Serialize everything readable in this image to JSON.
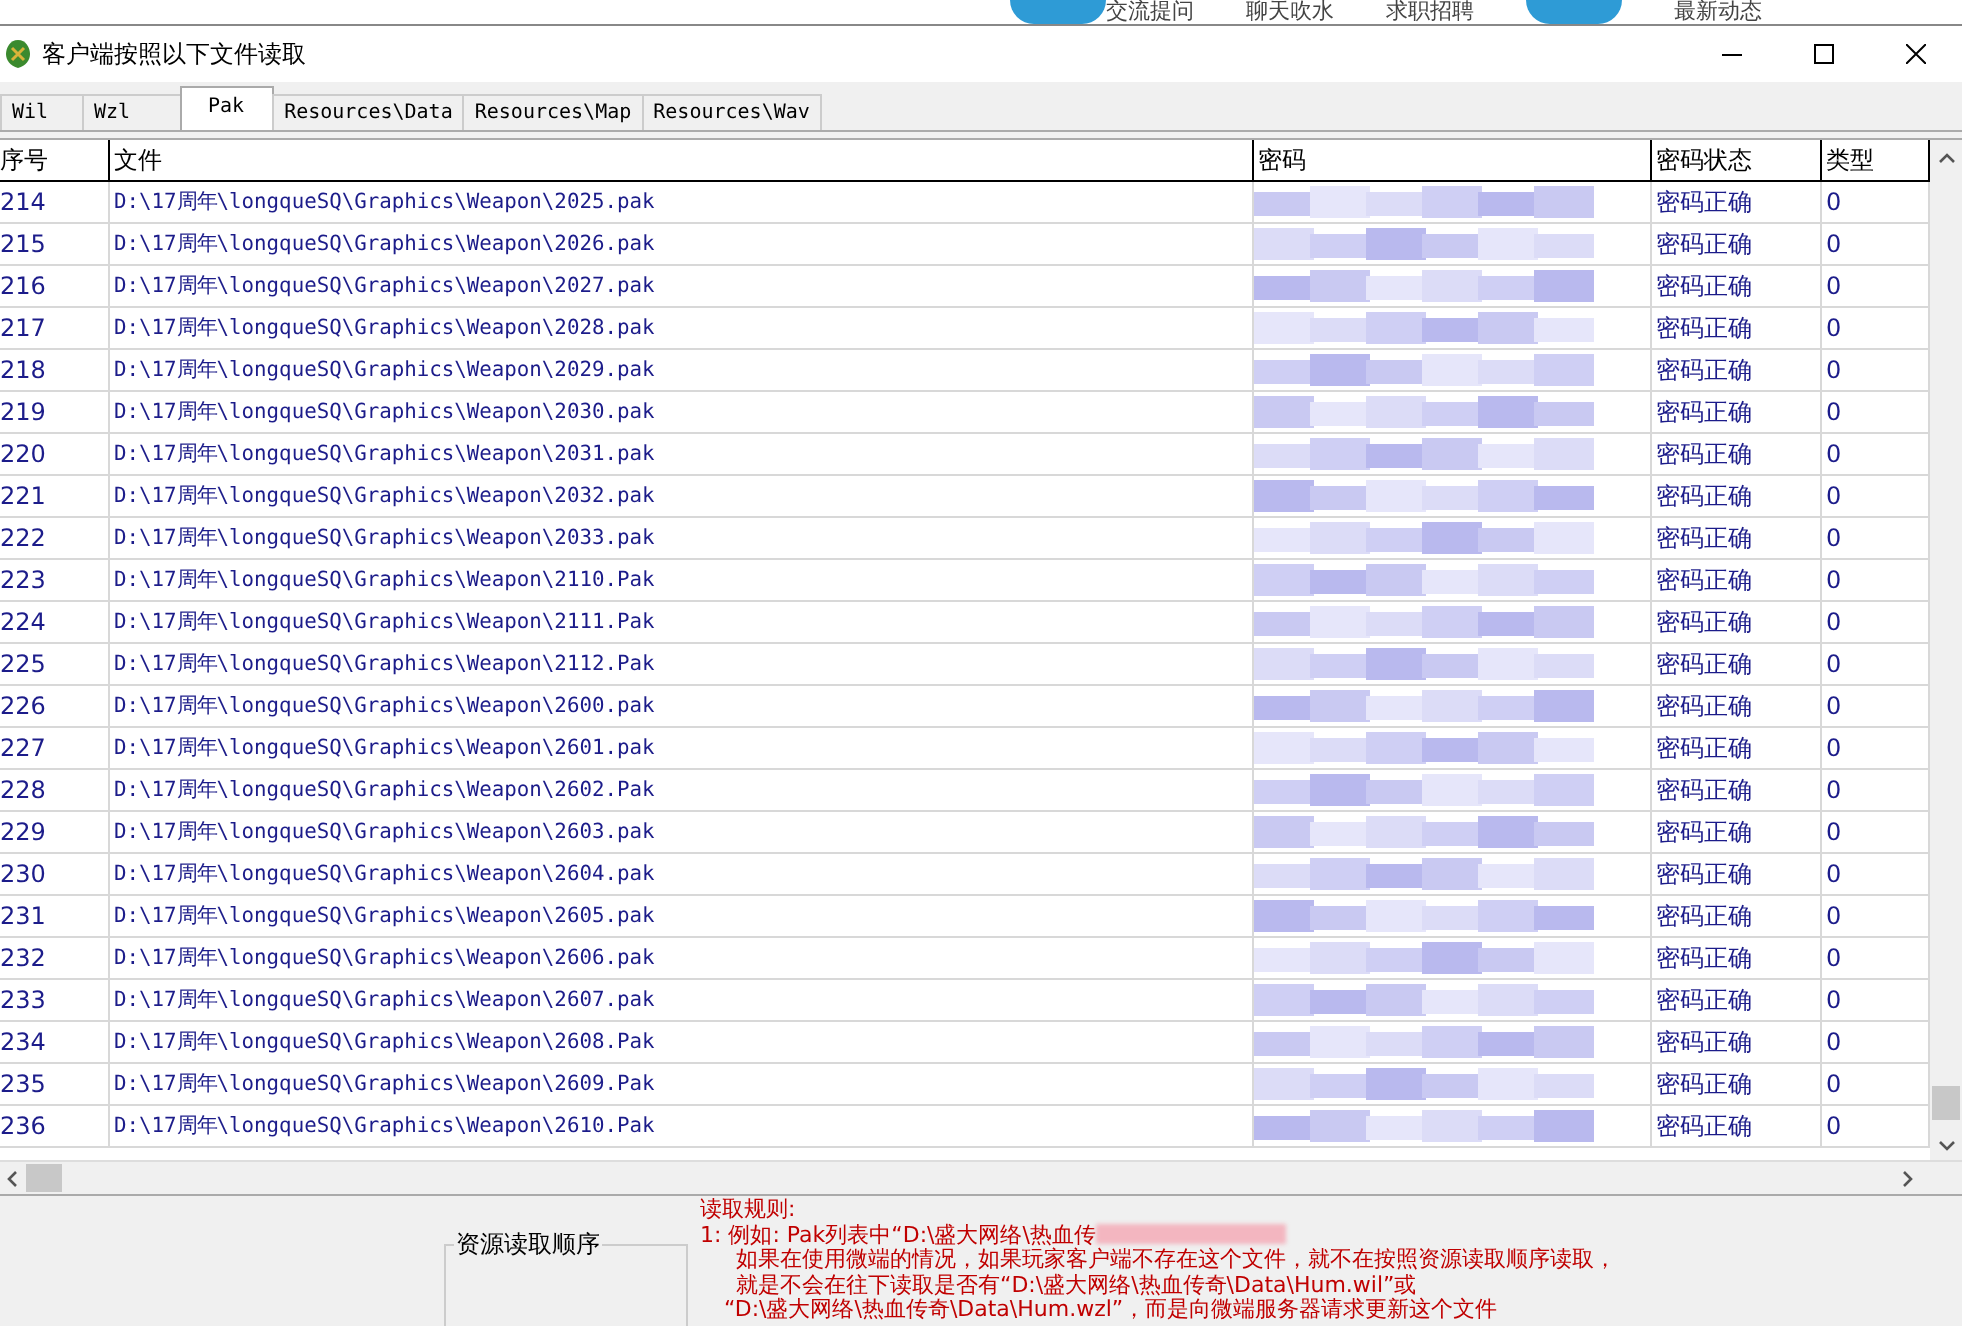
{
  "background_page": {
    "links": [
      "交流提问",
      "聊天吹水",
      "求职招聘",
      "最新动态"
    ]
  },
  "window": {
    "title": "客户端按照以下文件读取"
  },
  "tabs": [
    {
      "label": "Wil",
      "selected": false
    },
    {
      "label": "Wzl",
      "selected": false
    },
    {
      "label": "Pak",
      "selected": true
    },
    {
      "label": "Resources\\Data",
      "selected": false
    },
    {
      "label": "Resources\\Map",
      "selected": false
    },
    {
      "label": "Resources\\Wav",
      "selected": false
    }
  ],
  "table": {
    "columns": [
      "序号",
      "文件",
      "密码",
      "密码状态",
      "类型"
    ],
    "rows": [
      {
        "index": "214",
        "file": "D:\\17周年\\longqueSQ\\Graphics\\Weapon\\2025.pak",
        "status": "密码正确",
        "type": "0"
      },
      {
        "index": "215",
        "file": "D:\\17周年\\longqueSQ\\Graphics\\Weapon\\2026.pak",
        "status": "密码正确",
        "type": "0"
      },
      {
        "index": "216",
        "file": "D:\\17周年\\longqueSQ\\Graphics\\Weapon\\2027.pak",
        "status": "密码正确",
        "type": "0"
      },
      {
        "index": "217",
        "file": "D:\\17周年\\longqueSQ\\Graphics\\Weapon\\2028.pak",
        "status": "密码正确",
        "type": "0"
      },
      {
        "index": "218",
        "file": "D:\\17周年\\longqueSQ\\Graphics\\Weapon\\2029.pak",
        "status": "密码正确",
        "type": "0"
      },
      {
        "index": "219",
        "file": "D:\\17周年\\longqueSQ\\Graphics\\Weapon\\2030.pak",
        "status": "密码正确",
        "type": "0"
      },
      {
        "index": "220",
        "file": "D:\\17周年\\longqueSQ\\Graphics\\Weapon\\2031.pak",
        "status": "密码正确",
        "type": "0"
      },
      {
        "index": "221",
        "file": "D:\\17周年\\longqueSQ\\Graphics\\Weapon\\2032.pak",
        "status": "密码正确",
        "type": "0"
      },
      {
        "index": "222",
        "file": "D:\\17周年\\longqueSQ\\Graphics\\Weapon\\2033.pak",
        "status": "密码正确",
        "type": "0"
      },
      {
        "index": "223",
        "file": "D:\\17周年\\longqueSQ\\Graphics\\Weapon\\2110.Pak",
        "status": "密码正确",
        "type": "0"
      },
      {
        "index": "224",
        "file": "D:\\17周年\\longqueSQ\\Graphics\\Weapon\\2111.Pak",
        "status": "密码正确",
        "type": "0"
      },
      {
        "index": "225",
        "file": "D:\\17周年\\longqueSQ\\Graphics\\Weapon\\2112.Pak",
        "status": "密码正确",
        "type": "0"
      },
      {
        "index": "226",
        "file": "D:\\17周年\\longqueSQ\\Graphics\\Weapon\\2600.pak",
        "status": "密码正确",
        "type": "0"
      },
      {
        "index": "227",
        "file": "D:\\17周年\\longqueSQ\\Graphics\\Weapon\\2601.pak",
        "status": "密码正确",
        "type": "0"
      },
      {
        "index": "228",
        "file": "D:\\17周年\\longqueSQ\\Graphics\\Weapon\\2602.Pak",
        "status": "密码正确",
        "type": "0"
      },
      {
        "index": "229",
        "file": "D:\\17周年\\longqueSQ\\Graphics\\Weapon\\2603.pak",
        "status": "密码正确",
        "type": "0"
      },
      {
        "index": "230",
        "file": "D:\\17周年\\longqueSQ\\Graphics\\Weapon\\2604.pak",
        "status": "密码正确",
        "type": "0"
      },
      {
        "index": "231",
        "file": "D:\\17周年\\longqueSQ\\Graphics\\Weapon\\2605.pak",
        "status": "密码正确",
        "type": "0"
      },
      {
        "index": "232",
        "file": "D:\\17周年\\longqueSQ\\Graphics\\Weapon\\2606.pak",
        "status": "密码正确",
        "type": "0"
      },
      {
        "index": "233",
        "file": "D:\\17周年\\longqueSQ\\Graphics\\Weapon\\2607.pak",
        "status": "密码正确",
        "type": "0"
      },
      {
        "index": "234",
        "file": "D:\\17周年\\longqueSQ\\Graphics\\Weapon\\2608.Pak",
        "status": "密码正确",
        "type": "0"
      },
      {
        "index": "235",
        "file": "D:\\17周年\\longqueSQ\\Graphics\\Weapon\\2609.Pak",
        "status": "密码正确",
        "type": "0"
      },
      {
        "index": "236",
        "file": "D:\\17周年\\longqueSQ\\Graphics\\Weapon\\2610.Pak",
        "status": "密码正确",
        "type": "0"
      }
    ]
  },
  "order_box": {
    "title": "资源读取顺序"
  },
  "rules": {
    "title": "读取规则:",
    "lines": [
      "1: 例如: Pak列表中“D:\\盛大网络\\热血传",
      "如果在使用微端的情况，如果玩家客户端不存在这个文件，就不在按照资源读取顺序读取，",
      "就是不会在往下读取是否有“D:\\盛大网络\\热血传奇\\Data\\Hum.wil”或",
      "“D:\\盛大网络\\热血传奇\\Data\\Hum.wzl”，而是向微端服务器请求更新这个文件"
    ]
  }
}
